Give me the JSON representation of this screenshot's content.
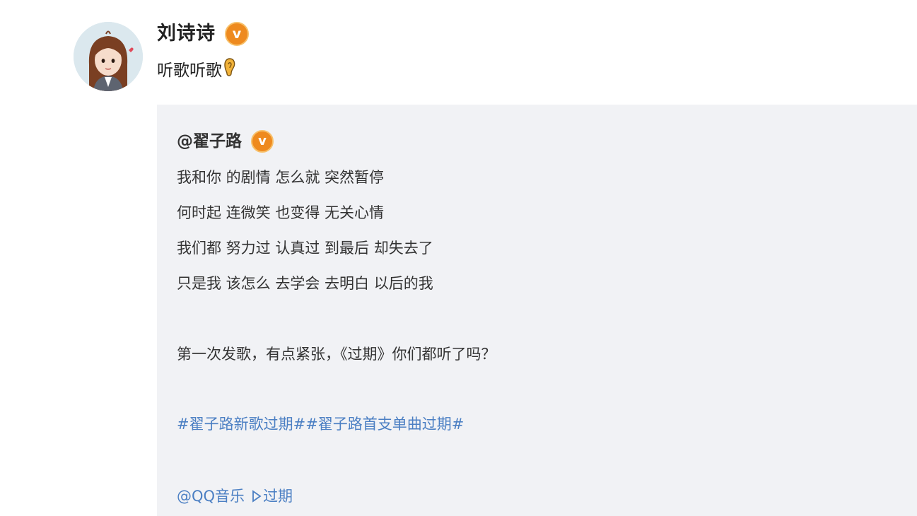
{
  "post": {
    "author": "刘诗诗",
    "verified_badge": "v",
    "text": "听歌听歌",
    "emoji": "ear-icon"
  },
  "repost": {
    "author": "@翟子路",
    "verified_badge": "v",
    "lyrics": [
      "我和你 的剧情 怎么就 突然暂停",
      "何时起 连微笑 也变得 无关心情",
      "我们都 努力过 认真过 到最后 却失去了",
      "只是我 该怎么 去学会 去明白 以后的我"
    ],
    "message": "第一次发歌，有点紧张，《过期》你们都听了吗？",
    "topics": "#翟子路新歌过期##翟子路首支单曲过期#",
    "mention": "@QQ音乐",
    "song_link": "过期"
  },
  "colors": {
    "link": "#4b7fc3",
    "badge": "#ee8a1f",
    "repost_bg": "#f1f2f5"
  }
}
